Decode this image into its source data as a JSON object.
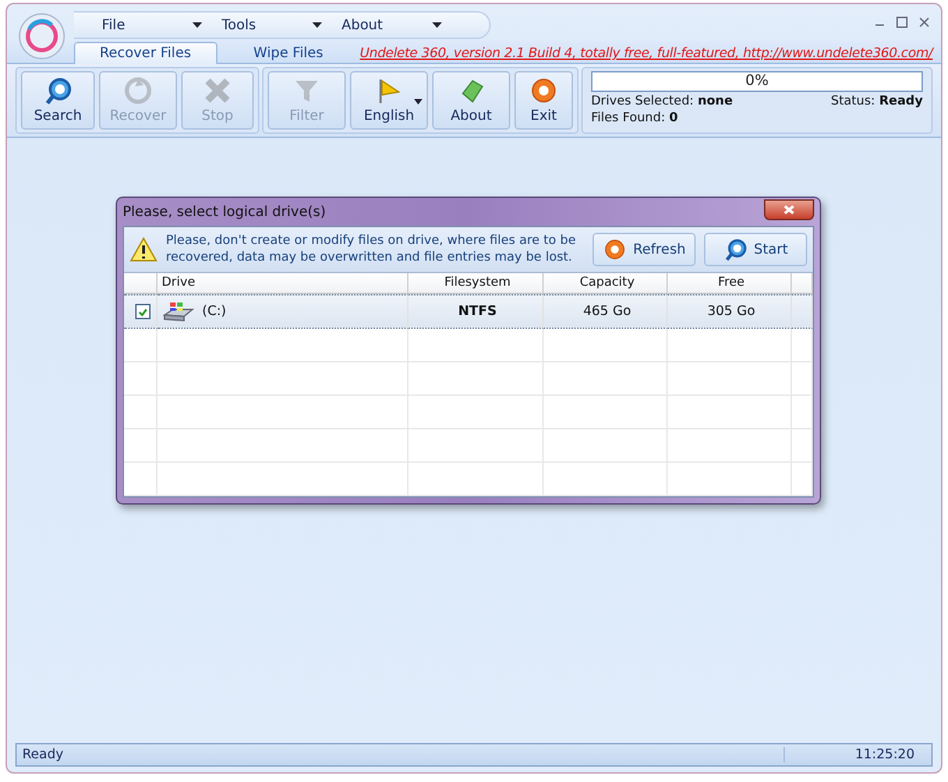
{
  "menu": [
    {
      "label": "File"
    },
    {
      "label": "Tools"
    },
    {
      "label": "About"
    }
  ],
  "tabs": [
    {
      "label": "Recover Files",
      "selected": true
    },
    {
      "label": "Wipe Files",
      "selected": false
    }
  ],
  "banner_link": "Undelete 360, version 2.1 Build 4, totally free, full-featured, http://www.undelete360.com/",
  "toolbar_groups": [
    [
      {
        "kind": "search",
        "label": "Search",
        "disabled": false
      },
      {
        "kind": "recover",
        "label": "Recover",
        "disabled": true
      },
      {
        "kind": "stop",
        "label": "Stop",
        "disabled": true
      }
    ],
    [
      {
        "kind": "filter",
        "label": "Filter",
        "disabled": true
      },
      {
        "kind": "language",
        "label": "English",
        "disabled": false
      },
      {
        "kind": "about",
        "label": "About",
        "disabled": false
      },
      {
        "kind": "exit",
        "label": "Exit",
        "disabled": false
      }
    ]
  ],
  "progress": {
    "level": 0,
    "reading": "0%"
  },
  "info": {
    "drives_selected": "Drives Selected: **none**",
    "files_found": "Files Found: **0**",
    "status": "Status: **Ready**"
  },
  "dialog": {
    "title": "Please, select logical drive(s)",
    "warning": "Please, don't create or modify files on drive, where files are to be recovered, data may be overwritten and file entries may be lost.",
    "buttons": [
      {
        "kind": "refresh",
        "label": "Refresh"
      },
      {
        "kind": "start",
        "label": "Start"
      }
    ],
    "columns": [
      "Drive",
      "Filesystem",
      "Capacity",
      "Free"
    ],
    "rows": [
      {
        "checked": true,
        "selected": true,
        "drive": "(C:)",
        "filesystem": "NTFS",
        "capacity": "465 Go",
        "free": "305 Go"
      }
    ]
  },
  "status_bar": {
    "text": "Ready",
    "time": "11:25:20"
  }
}
